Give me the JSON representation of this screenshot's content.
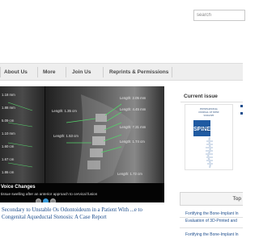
{
  "search": {
    "placeholder": "search"
  },
  "nav": {
    "items": [
      "About Us",
      "More",
      "Join Us",
      "Reprints & Permissions"
    ]
  },
  "slider": {
    "title": "Voice Changes",
    "subtitle": "tissue swelling after an anterior approach to cervical fusion",
    "slide_count": 3,
    "active_slide": 2,
    "left_labels": [
      "1.18 mm",
      "1.88 mm",
      "5.09 cm",
      "1.10 mm",
      "1.60 cm",
      "1.67 cm",
      "1.86 cm"
    ],
    "right_labels": [
      "Length: 1.35 cm",
      "Length: 2.05 mm",
      "Length: 4.45 mm",
      "Length: 1.53 cm",
      "Length: 7.31 mm",
      "Length: 1.74 cm",
      "Length: 1.72 cm"
    ]
  },
  "article": {
    "title": "Secondary to Unstable Os Odontoideum in a Patient With ...e to Congenital Aqueductal Stenosis: A Case Report"
  },
  "sidebar": {
    "current_issue_label": "Current issue",
    "cover": {
      "line1": "INTERNATIONAL",
      "line2": "JOURNAL OF SPINE",
      "line3": "SURGERY",
      "spine_word": "SPINE",
      "line4": "JOURNAL",
      "line5": "SURGERY"
    },
    "tab_label": "Top",
    "toc_links": [
      "Fortifying the Bone-Implant In",
      "Evaluation of 3D-Printed and",
      "Fortifying the Bone-Implant In"
    ]
  },
  "colors": {
    "link": "#1f4f8e",
    "active_dot": "#3a9bd9",
    "nav_bg": "#eeeeee"
  }
}
